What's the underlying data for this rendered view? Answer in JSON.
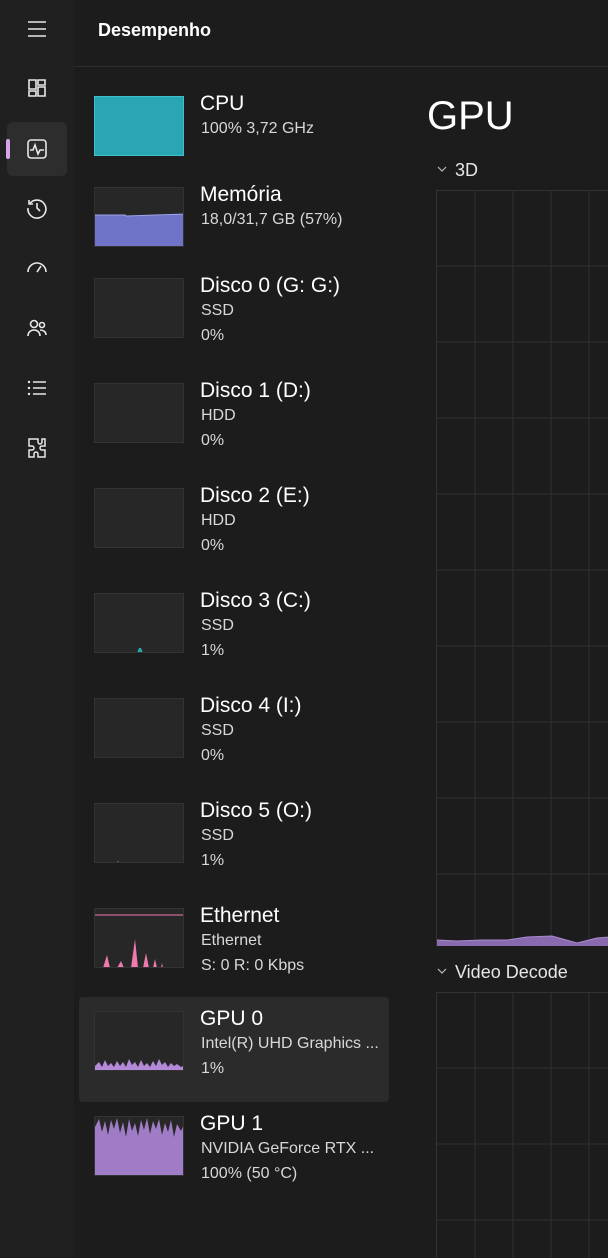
{
  "header": {
    "title": "Desempenho"
  },
  "nav": {
    "items": [
      {
        "name": "menu",
        "icon": "hamburger-icon"
      },
      {
        "name": "processes",
        "icon": "processes-icon"
      },
      {
        "name": "performance",
        "icon": "performance-icon",
        "active": true
      },
      {
        "name": "app-history",
        "icon": "history-icon"
      },
      {
        "name": "startup",
        "icon": "startup-icon"
      },
      {
        "name": "users",
        "icon": "users-icon"
      },
      {
        "name": "details",
        "icon": "details-list-icon"
      },
      {
        "name": "services",
        "icon": "services-icon"
      }
    ],
    "accent_color": "#d8a4e8"
  },
  "devices": [
    {
      "title": "CPU",
      "line1": "100%  3,72 GHz",
      "line2": "",
      "color": "#2aa6b2",
      "usage": 100
    },
    {
      "title": "Memória",
      "line1": "18,0/31,7 GB (57%)",
      "line2": "",
      "color": "#6f74c8",
      "usage": 57
    },
    {
      "title": "Disco 0 (G: G:)",
      "line1": "SSD",
      "line2": "0%",
      "color": "#2aa6b2",
      "usage": 0
    },
    {
      "title": "Disco 1 (D:)",
      "line1": "HDD",
      "line2": "0%",
      "color": "#2aa6b2",
      "usage": 0
    },
    {
      "title": "Disco 2 (E:)",
      "line1": "HDD",
      "line2": "0%",
      "color": "#2aa6b2",
      "usage": 0
    },
    {
      "title": "Disco 3 (C:)",
      "line1": "SSD",
      "line2": "1%",
      "color": "#2aa6b2",
      "usage": 1
    },
    {
      "title": "Disco 4 (I:)",
      "line1": "SSD",
      "line2": "0%",
      "color": "#2aa6b2",
      "usage": 0
    },
    {
      "title": "Disco 5 (O:)",
      "line1": "SSD",
      "line2": "1%",
      "color": "#2aa6b2",
      "usage": 1
    },
    {
      "title": "Ethernet",
      "line1": "Ethernet",
      "line2": "S: 0  R: 0 Kbps",
      "color": "#f07ab0",
      "usage": 0
    },
    {
      "title": "GPU 0",
      "line1": "Intel(R) UHD Graphics ...",
      "line2": "1%",
      "color": "#b48ad8",
      "usage": 1,
      "selected": true
    },
    {
      "title": "GPU 1",
      "line1": "NVIDIA GeForce RTX ...",
      "line2": "100% (50 °C)",
      "color": "#b48ad8",
      "usage": 100
    }
  ],
  "detail": {
    "title": "GPU",
    "sections": [
      {
        "label": "3D"
      },
      {
        "label": "Video Decode"
      }
    ]
  }
}
